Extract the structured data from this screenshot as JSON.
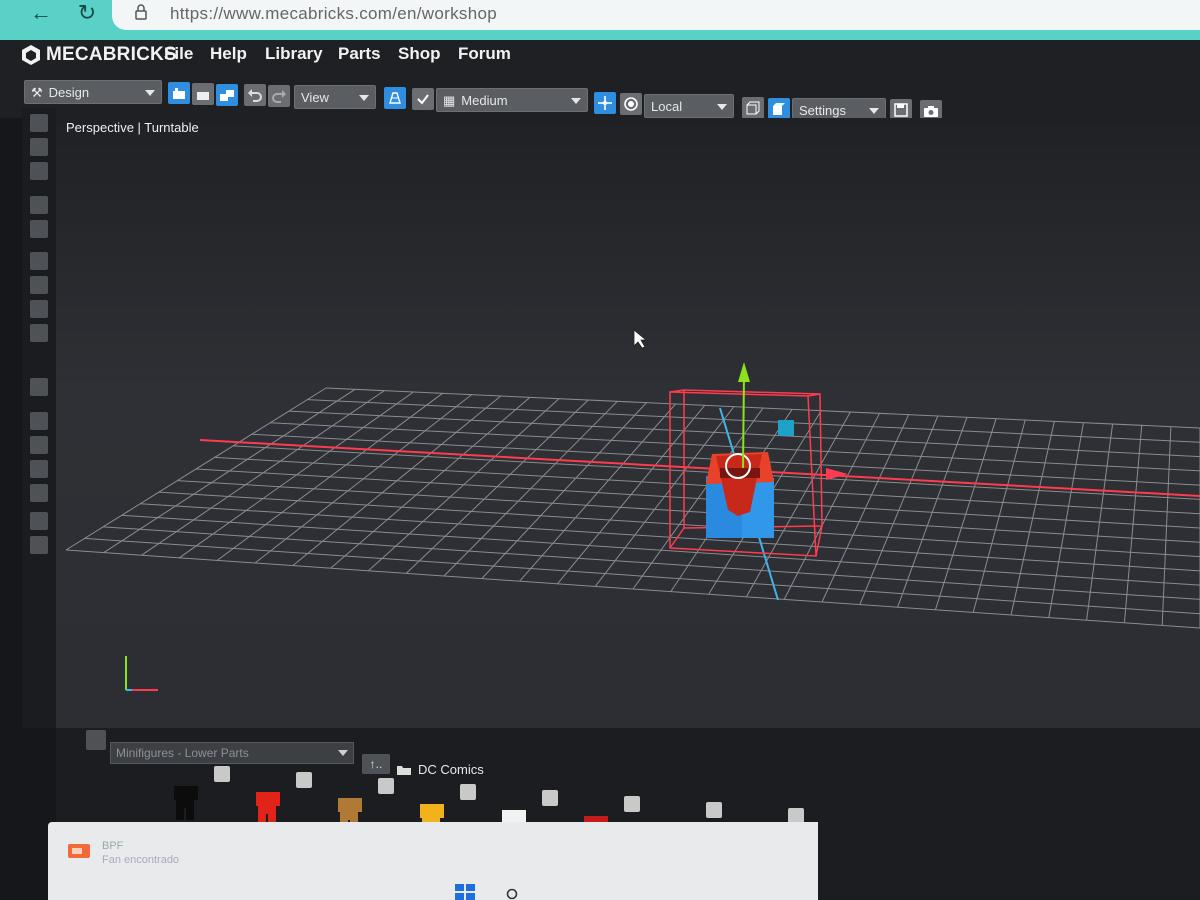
{
  "browser": {
    "url": "https://www.mecabricks.com/en/workshop",
    "back_icon": "back-arrow-icon",
    "reload_icon": "reload-icon",
    "lock_icon": "lock-icon"
  },
  "app": {
    "brand": "MECABRICKS",
    "menu": [
      "File",
      "Help",
      "Library",
      "Parts",
      "Shop",
      "Forum"
    ]
  },
  "toolbar": {
    "mode_select": "Design",
    "view_select": "View",
    "grid_select": "Medium",
    "space_select": "Local",
    "settings_select": "Settings"
  },
  "viewport": {
    "mode_label": "Perspective | Turntable"
  },
  "parts_panel": {
    "category": "Minifigures - Lower Parts",
    "up_button": "↑..",
    "folder": "DC Comics",
    "parts": [
      {
        "id": "73200a476",
        "color": "#0c0c0c"
      },
      {
        "id": "73200a498",
        "color": "#e2231a"
      },
      {
        "id": "73200a502",
        "color": "#b07a36"
      },
      {
        "id": "73200a503",
        "color": "#f2b21b"
      },
      {
        "id": "73200a671",
        "color": "#f2f2f2"
      },
      {
        "id": "73200a733",
        "color": "#c41c1c"
      },
      {
        "id": "77601a882",
        "color": "#111111"
      },
      {
        "id": "73200a883",
        "color": "#e2231a"
      }
    ]
  },
  "notification": {
    "title": "BPF",
    "body": "Fan encontrado"
  },
  "colors": {
    "accent_blue": "#2f8ee0",
    "selection_red": "#ff3b4f",
    "axis_green": "#8ee21a",
    "axis_blue": "#3fb6e8"
  }
}
